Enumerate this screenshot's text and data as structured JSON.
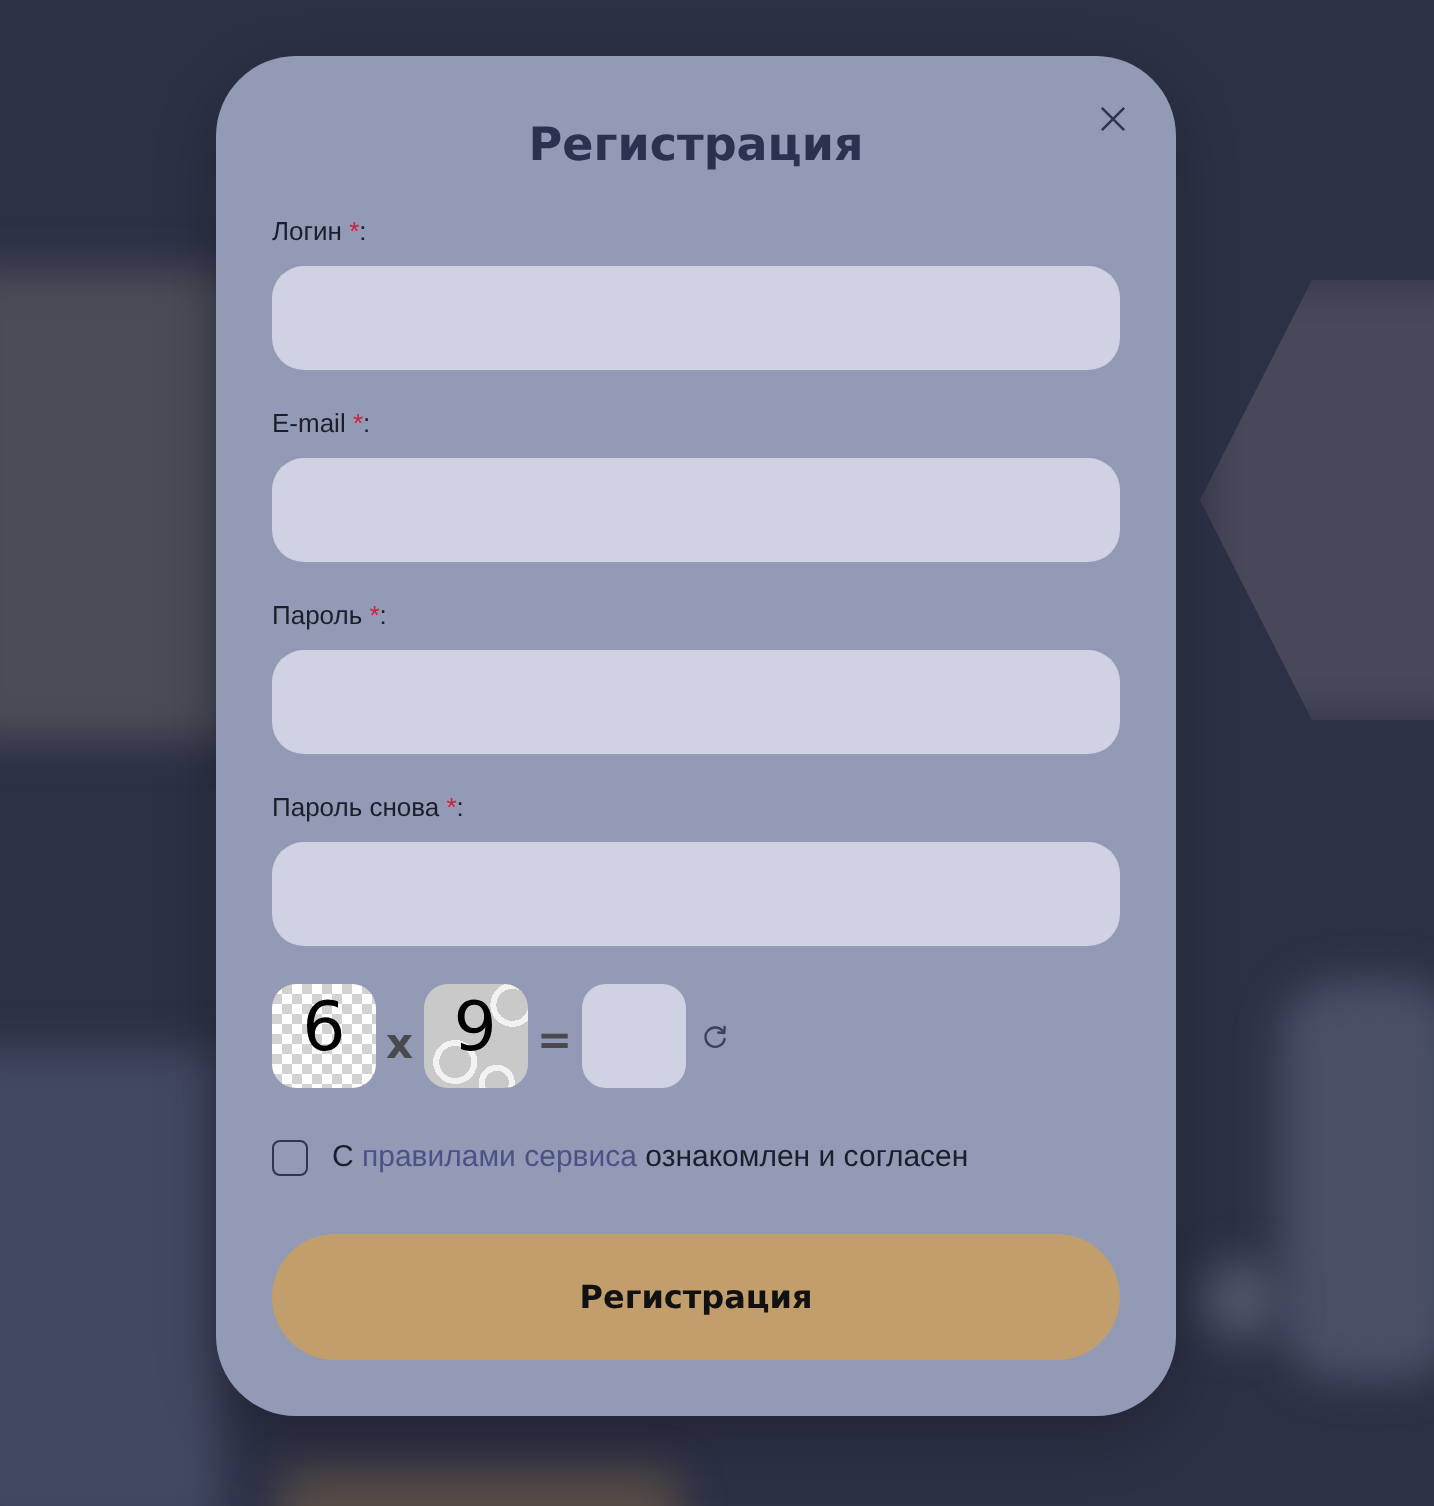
{
  "dialog": {
    "title": "Регистрация"
  },
  "fields": [
    {
      "label": "Логин",
      "required_mark": "*",
      "label_end": ":"
    },
    {
      "label": "E-mail",
      "required_mark": "*",
      "label_end": ":"
    },
    {
      "label": "Пароль",
      "required_mark": "*",
      "label_end": ":"
    },
    {
      "label": "Пароль снова",
      "required_mark": "*",
      "label_end": ":"
    }
  ],
  "captcha": {
    "operand_1": "6",
    "operator": "x",
    "operand_2": "9",
    "equals": "="
  },
  "agreement": {
    "checked": false,
    "text_before": "С",
    "link": "правилами сервиса",
    "text_after": "ознакомлен и согласен"
  },
  "submit_button": {
    "label": "Регистрация"
  }
}
